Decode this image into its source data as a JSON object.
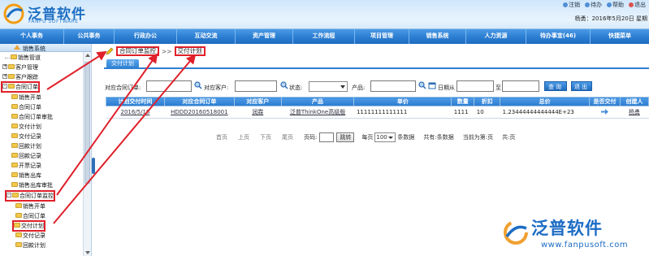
{
  "app": {
    "logo_cn": "泛普软件",
    "logo_en": "FANPU SOFTWARE",
    "top_links": [
      "注销",
      "待办",
      "帮助",
      "退出"
    ],
    "user_info": "杨勇：2016年5月20日 星期"
  },
  "nav": {
    "items": [
      "个人事务",
      "公共事务",
      "行政办公",
      "互动交流",
      "资产管理",
      "工作流程",
      "项目管理",
      "销售系统",
      "人力资源",
      "待办事宜(46)",
      "快捷菜单"
    ]
  },
  "sidebar": {
    "title": "销售系统",
    "items": [
      {
        "label": "销售管道",
        "expander": ""
      },
      {
        "label": "客户管理",
        "expander": "+"
      },
      {
        "label": "客户跟踪",
        "expander": "+"
      },
      {
        "label": "合同订单",
        "expander": "-"
      },
      {
        "label": "销售开单",
        "expander": ""
      },
      {
        "label": "合同订单",
        "expander": ""
      },
      {
        "label": "合同订单审批",
        "expander": ""
      },
      {
        "label": "交付计划",
        "expander": ""
      },
      {
        "label": "交付记录",
        "expander": ""
      },
      {
        "label": "回款计划",
        "expander": ""
      },
      {
        "label": "回款记录",
        "expander": ""
      },
      {
        "label": "开票记录",
        "expander": ""
      },
      {
        "label": "销售出库",
        "expander": ""
      },
      {
        "label": "销售出库审批",
        "expander": ""
      },
      {
        "label": "合同订单监控",
        "expander": "-"
      },
      {
        "label": "销售开单",
        "expander": ""
      },
      {
        "label": "合同订单",
        "expander": ""
      },
      {
        "label": "交付计划",
        "expander": ""
      },
      {
        "label": "交付记录",
        "expander": ""
      },
      {
        "label": "回款计划",
        "expander": ""
      }
    ]
  },
  "breadcrumb": {
    "first": "合同订单监控",
    "separator": ">>",
    "second": "交付计划"
  },
  "tab": {
    "active": "交付计划"
  },
  "filters": {
    "order_label": "对应合同订单:",
    "customer_label": "对应客户:",
    "status_label": "状态:",
    "product_label": "产品:",
    "date_label": "日期从",
    "date_to": "至",
    "query_button": "查询",
    "back_button": "退出"
  },
  "table": {
    "headers": [
      "计划交付时间",
      "对应合同订单",
      "对应客户",
      "产品",
      "单价",
      "数量",
      "折扣",
      "总价",
      "是否交付",
      "创建人"
    ],
    "rows": [
      {
        "date": "2016/5/18",
        "order": "HDDD20160518001",
        "customer": "润霖",
        "product": "泛普ThinkOne高级版",
        "price": "11111111111111",
        "qty": "1111",
        "discount": "10",
        "total": "1.23444444444444E+23",
        "delivered_icon": "arrow-right-icon",
        "creator": "杨勇"
      }
    ]
  },
  "pager": {
    "first": "首页",
    "prev": "上页",
    "next": "下页",
    "last": "尾页",
    "page_label": "页码:",
    "go": "跳转",
    "per_page_label": "每页",
    "per_page": "100",
    "per_page_suffix": "条数据",
    "total": "共有:条数据",
    "current": "当前为第:页",
    "pages": "共:页"
  },
  "watermark": {
    "brand": "泛普软件",
    "url": "www.fanpusoft.com"
  },
  "colors": {
    "accent": "#2f80d1",
    "highlight": "#e0202a"
  }
}
